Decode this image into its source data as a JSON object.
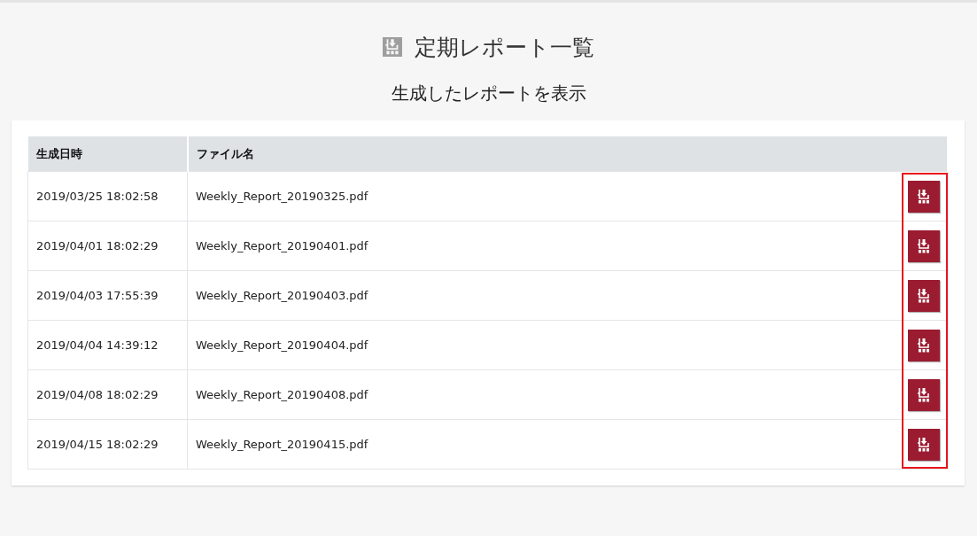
{
  "title": "定期レポート一覧",
  "subtitle": "生成したレポートを表示",
  "table": {
    "columns": [
      "生成日時",
      "ファイル名"
    ],
    "download_column_highlighted": true,
    "rows": [
      {
        "generated_at": "2019/03/25 18:02:58",
        "file_name": "Weekly_Report_20190325.pdf"
      },
      {
        "generated_at": "2019/04/01 18:02:29",
        "file_name": "Weekly_Report_20190401.pdf"
      },
      {
        "generated_at": "2019/04/03 17:55:39",
        "file_name": "Weekly_Report_20190403.pdf"
      },
      {
        "generated_at": "2019/04/04 14:39:12",
        "file_name": "Weekly_Report_20190404.pdf"
      },
      {
        "generated_at": "2019/04/08 18:02:29",
        "file_name": "Weekly_Report_20190408.pdf"
      },
      {
        "generated_at": "2019/04/15 18:02:29",
        "file_name": "Weekly_Report_20190415.pdf"
      }
    ]
  }
}
